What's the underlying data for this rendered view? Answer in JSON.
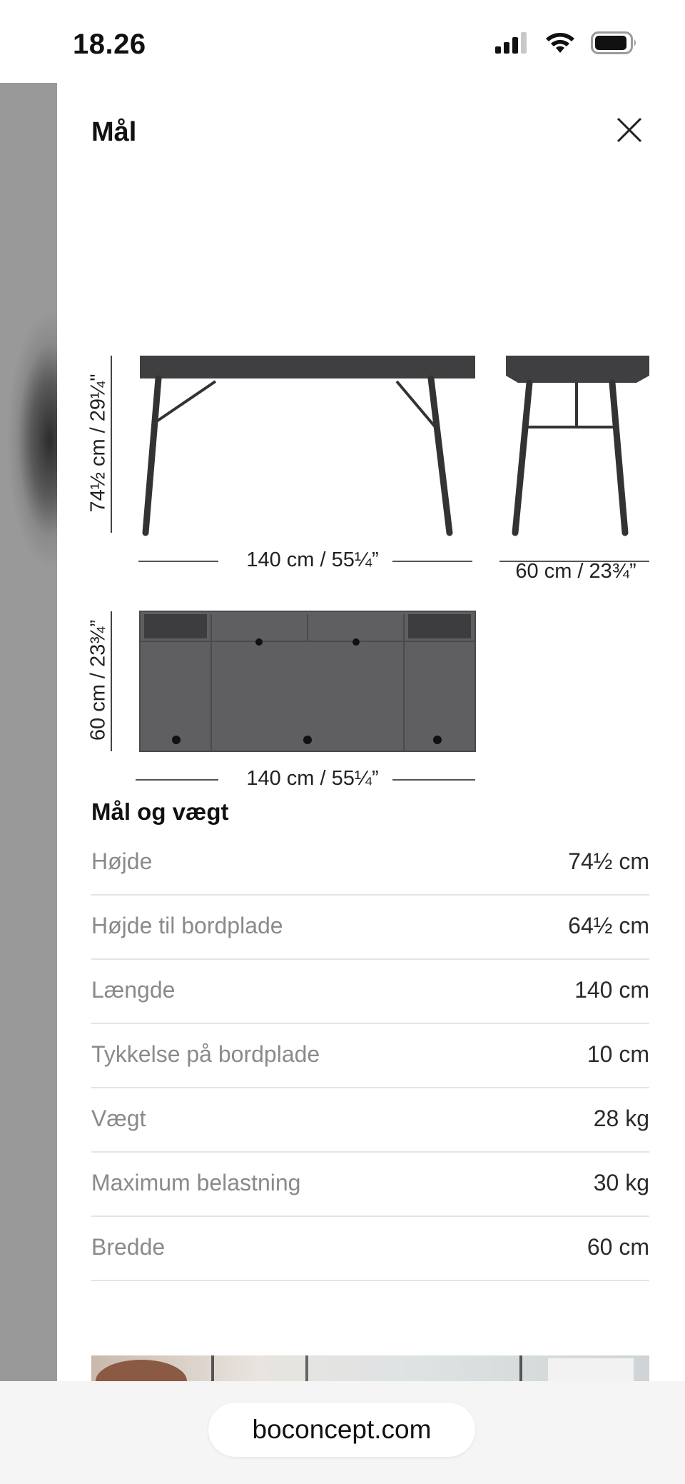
{
  "status_bar": {
    "time": "18.26",
    "icons": [
      "cellular-signal-icon",
      "wifi-icon",
      "battery-icon"
    ]
  },
  "sheet": {
    "title": "Mål",
    "close_icon": "close-icon"
  },
  "drawings": {
    "front_view": {
      "height_label": "74½ cm / 29¼\"",
      "width_label": "140 cm / 55¼”"
    },
    "side_view": {
      "depth_label": "60 cm / 23¾”"
    },
    "top_view": {
      "depth_label": "60 cm / 23¾”",
      "width_label": "140 cm / 55¼”"
    },
    "colors": {
      "product": "#5f5f61",
      "product_dark": "#3c3c3e",
      "leg": "#3a3a3c"
    }
  },
  "specs": {
    "title": "Mål og vægt",
    "rows": [
      {
        "label": "Højde",
        "value": "74½ cm"
      },
      {
        "label": "Højde til bordplade",
        "value": "64½ cm"
      },
      {
        "label": "Længde",
        "value": "140 cm"
      },
      {
        "label": "Tykkelse på bordplade",
        "value": "10 cm"
      },
      {
        "label": "Vægt",
        "value": "28 kg"
      },
      {
        "label": "Maximum belastning",
        "value": "30 kg"
      },
      {
        "label": "Bredde",
        "value": "60 cm"
      }
    ]
  },
  "browser": {
    "url": "boconcept.com"
  }
}
